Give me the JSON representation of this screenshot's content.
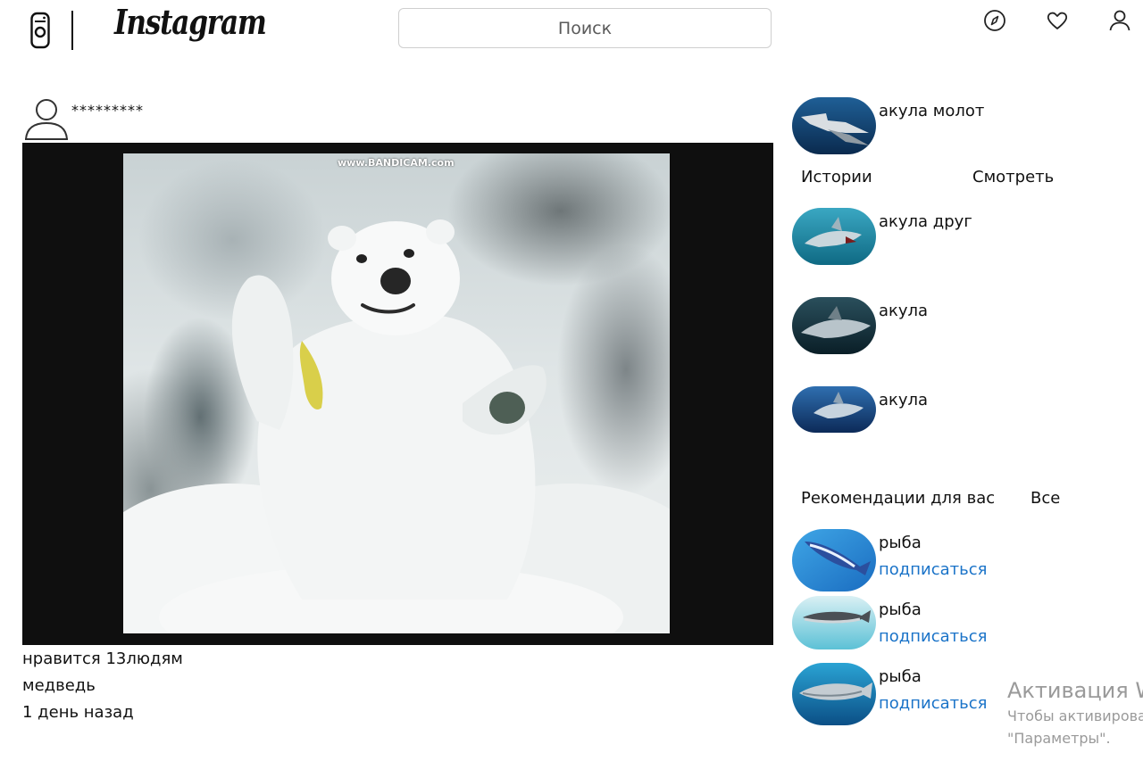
{
  "header": {
    "brand": "Instagram",
    "search_placeholder": "Поиск",
    "icons": [
      "compass-icon",
      "heart-icon",
      "profile-icon"
    ]
  },
  "post": {
    "username": "*********",
    "video_watermark": "www.BANDICAM.com",
    "likes": "нравится 13людям",
    "caption": "медведь",
    "time": "1 день назад"
  },
  "sidebar": {
    "top_story": {
      "name": "акула молот"
    },
    "stories_header": "Истории",
    "watch_label": "Смотреть",
    "stories": [
      {
        "name": "акула друг"
      },
      {
        "name": "акула"
      },
      {
        "name": "акула"
      }
    ],
    "recommend_header": "Рекомендации для вас",
    "all_label": "Все",
    "recommendations": [
      {
        "name": "рыба",
        "action": "подписаться"
      },
      {
        "name": "рыба",
        "action": "подписаться"
      },
      {
        "name": "рыба",
        "action": "подписаться"
      }
    ]
  },
  "watermark": {
    "title": "Активация W",
    "line1": "Чтобы активирова",
    "line2": "\"Параметры\"."
  },
  "colors": {
    "link": "#1a73c8",
    "text": "#111111",
    "video_bg": "#0f0f0f",
    "watermark": "#9a9a9a"
  }
}
